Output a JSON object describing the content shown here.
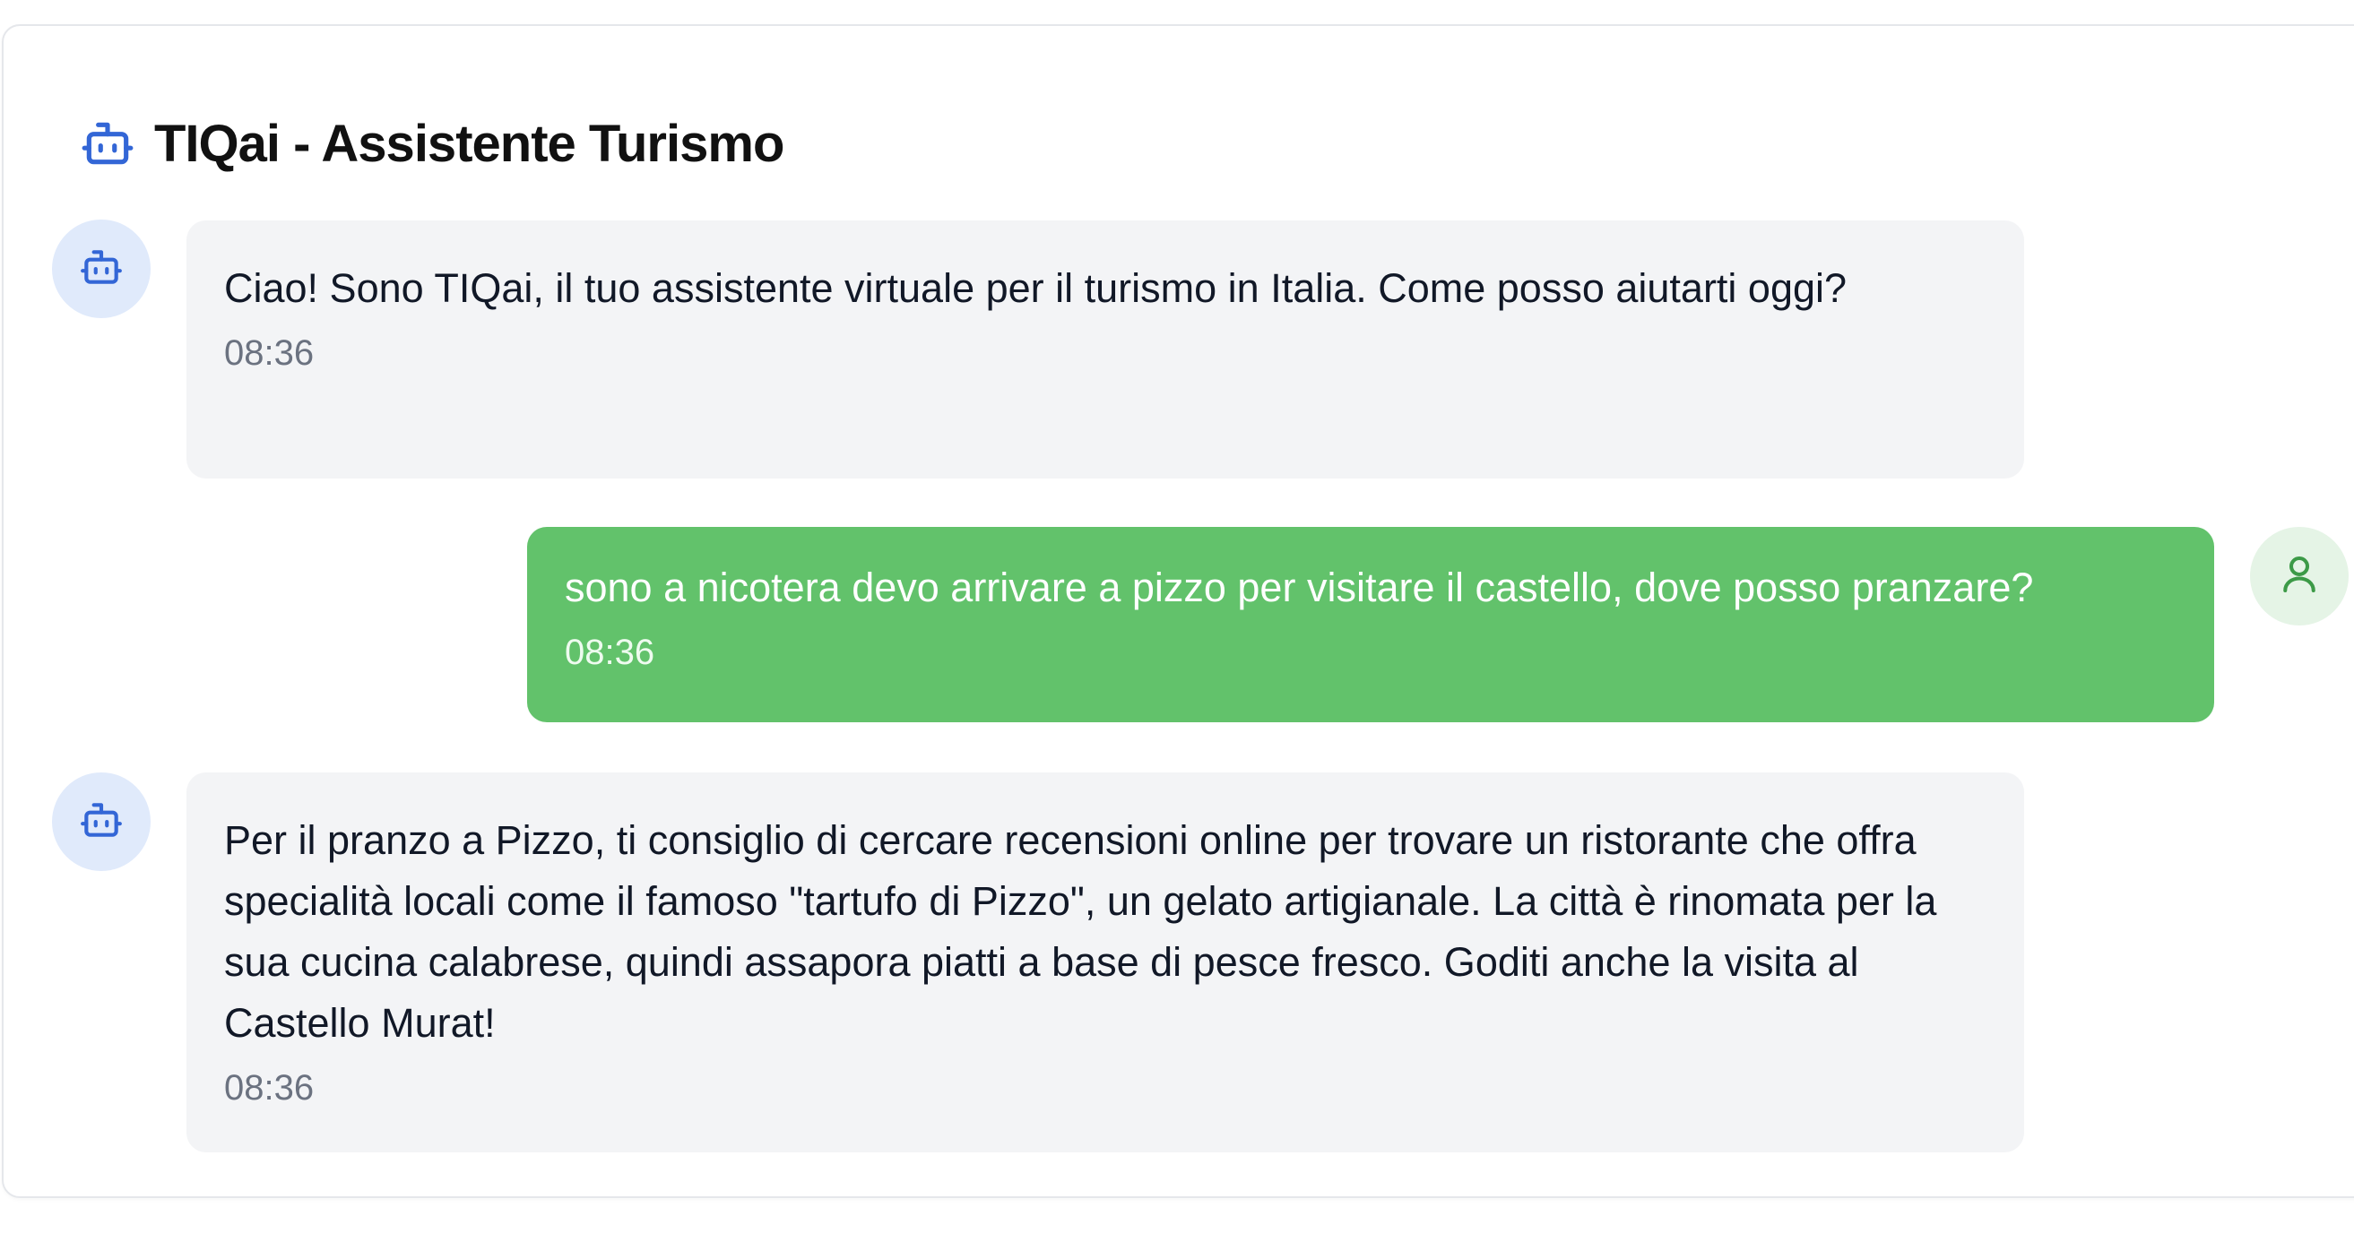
{
  "header": {
    "title": "TIQai - Assistente Turismo",
    "icon": "bot-icon",
    "accent_color": "#3366d6"
  },
  "messages": [
    {
      "role": "bot",
      "text": "Ciao! Sono TIQai, il tuo assistente virtuale per il turismo in Italia. Come posso aiutarti oggi?",
      "time": "08:36",
      "avatar_icon": "bot-icon"
    },
    {
      "role": "user",
      "text": "sono a nicotera devo arrivare a pizzo per visitare il castello, dove posso pranzare?",
      "time": "08:36",
      "avatar_icon": "user-icon"
    },
    {
      "role": "bot",
      "text": "Per il pranzo a Pizzo, ti consiglio di cercare recensioni online per trovare un ristorante che offra specialità locali come il famoso \"tartufo di Pizzo\", un gelato artigianale. La città è rinomata per la sua cucina calabrese, quindi assapora piatti a base di pesce fresco. Goditi anche la visita al Castello Murat!",
      "time": "08:36",
      "avatar_icon": "bot-icon"
    }
  ],
  "colors": {
    "bot_bubble": "#f3f4f6",
    "user_bubble": "#62c26b",
    "bot_avatar_bg": "#e0eafb",
    "user_avatar_bg": "#e5f4e6",
    "user_icon": "#3c9a47"
  }
}
